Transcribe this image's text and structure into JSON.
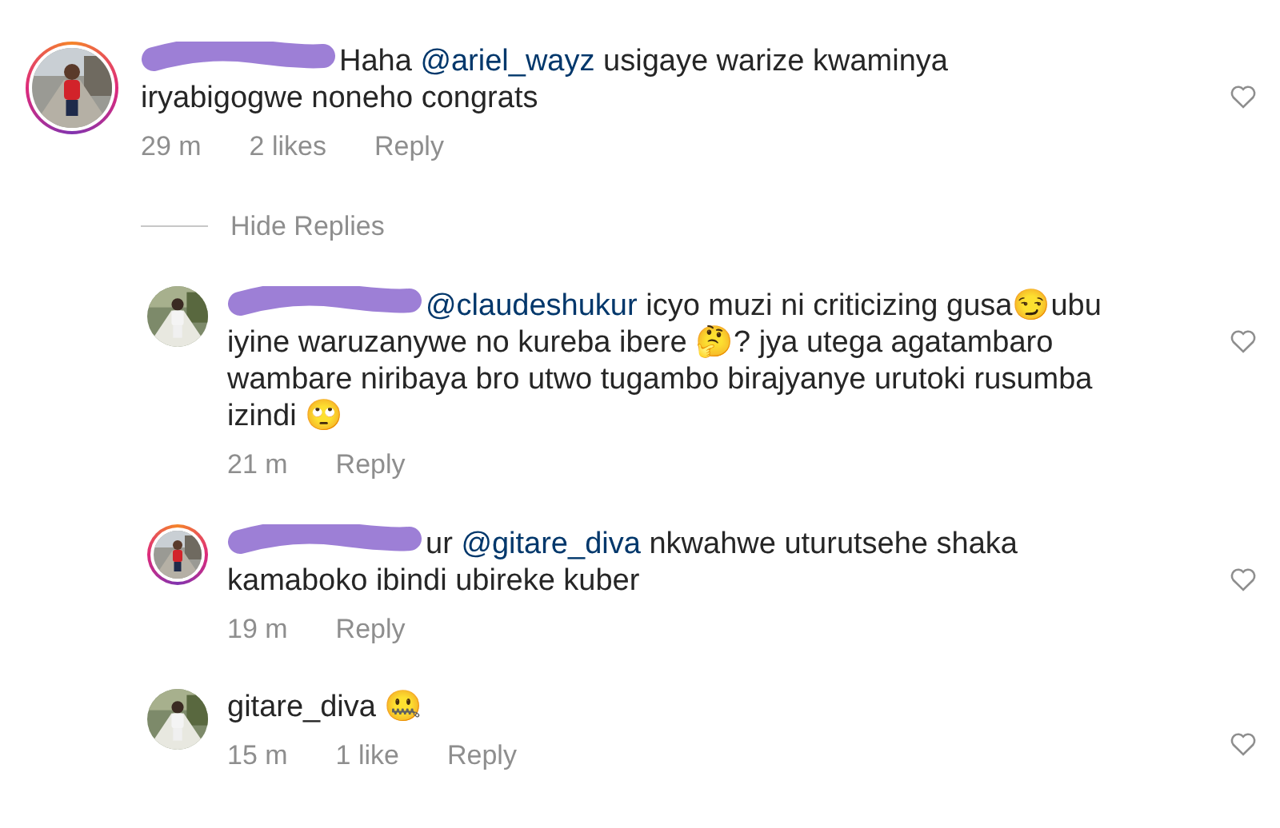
{
  "thread": {
    "comment": {
      "redacted": true,
      "mention": "@ariel_wayz",
      "text": "Haha",
      "text_after": "usigaye warize kwaminya iryabigogwe noneho congrats",
      "time": "29 m",
      "likes": "2 likes",
      "reply": "Reply",
      "liked": false,
      "story_ring": true
    },
    "hide_replies": "Hide Replies",
    "replies": [
      {
        "redacted": true,
        "mention": "@claudeshukur",
        "text_after": " icyo muzi ni criticizing gusa😏ubu iyine waruzanywe no kureba ibere 🤔? jya utega agatambaro wambare niribaya bro utwo tugambo birajyanye urutoki rusumba izindi 🙄",
        "time": "21 m",
        "reply": "Reply",
        "liked": false,
        "story_ring": false
      },
      {
        "redacted": true,
        "username": "ur",
        "mention": "@gitare_diva",
        "text_after": "nkwahwe uturutsehe shaka kamaboko ibindi ubireke kuber",
        "time": "19 m",
        "reply": "Reply",
        "liked": false,
        "story_ring": true
      },
      {
        "redacted": false,
        "username": "gitare_diva",
        "text_after": "🤐",
        "time": "15 m",
        "likes": "1 like",
        "reply": "Reply",
        "liked": false,
        "story_ring": false
      }
    ]
  }
}
